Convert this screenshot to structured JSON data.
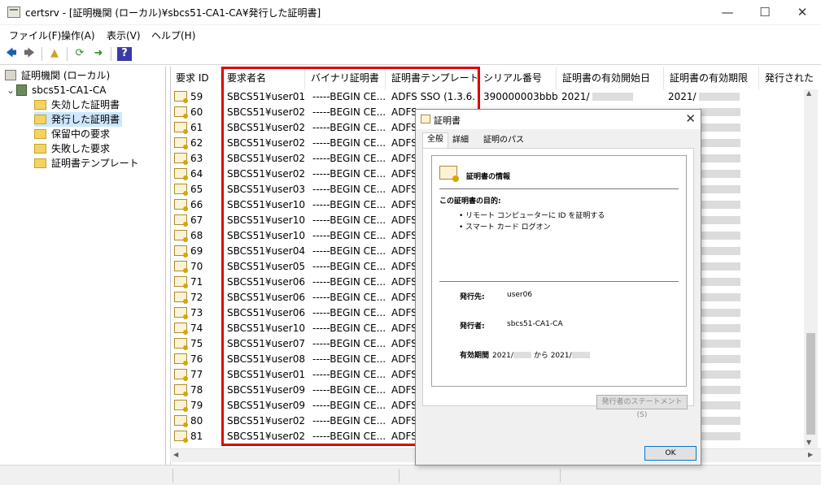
{
  "window": {
    "title": "certsrv - [証明機関 (ローカル)¥sbcs51-CA1-CA¥発行した証明書]",
    "controls": [
      "—",
      "☐",
      "✕"
    ]
  },
  "menu": [
    "ファイル(F)",
    "操作(A)",
    "表示(V)",
    "ヘルプ(H)"
  ],
  "toolbar": {
    "back": "🡄",
    "forward": "🡆",
    "up": "▲",
    "refresh": "⟳",
    "export": "➜",
    "help": "?"
  },
  "tree": {
    "root": "証明機関 (ローカル)",
    "ca": "sbcs51-CA1-CA",
    "expand_glyph": "⌄",
    "folders": [
      "失効した証明書",
      "発行した証明書",
      "保留中の要求",
      "失敗した要求",
      "証明書テンプレート"
    ],
    "selected_index": 1
  },
  "list": {
    "columns": [
      "要求 ID",
      "要求者名",
      "バイナリ証明書",
      "証明書テンプレート",
      "シリアル番号",
      "証明書の有効開始日",
      "証明書の有効期限",
      "発行された"
    ],
    "first_row": {
      "template": "ADFS SSO (1.3.6.1...",
      "serial": "390000003bbb...",
      "start": "2021/",
      "expire": "2021/"
    },
    "rows": [
      {
        "id": "59",
        "requester": "SBCS51¥user01",
        "binary": "-----BEGIN CE...",
        "template": "ADFS"
      },
      {
        "id": "60",
        "requester": "SBCS51¥user02",
        "binary": "-----BEGIN CE...",
        "template": "ADFS"
      },
      {
        "id": "61",
        "requester": "SBCS51¥user02",
        "binary": "-----BEGIN CE...",
        "template": "ADFS"
      },
      {
        "id": "62",
        "requester": "SBCS51¥user02",
        "binary": "-----BEGIN CE...",
        "template": "ADFS"
      },
      {
        "id": "63",
        "requester": "SBCS51¥user02",
        "binary": "-----BEGIN CE...",
        "template": "ADFS"
      },
      {
        "id": "64",
        "requester": "SBCS51¥user02",
        "binary": "-----BEGIN CE...",
        "template": "ADFS"
      },
      {
        "id": "65",
        "requester": "SBCS51¥user03",
        "binary": "-----BEGIN CE...",
        "template": "ADFS"
      },
      {
        "id": "66",
        "requester": "SBCS51¥user10",
        "binary": "-----BEGIN CE...",
        "template": "ADFS"
      },
      {
        "id": "67",
        "requester": "SBCS51¥user10",
        "binary": "-----BEGIN CE...",
        "template": "ADFS"
      },
      {
        "id": "68",
        "requester": "SBCS51¥user10",
        "binary": "-----BEGIN CE...",
        "template": "ADFS"
      },
      {
        "id": "69",
        "requester": "SBCS51¥user04",
        "binary": "-----BEGIN CE...",
        "template": "ADFS"
      },
      {
        "id": "70",
        "requester": "SBCS51¥user05",
        "binary": "-----BEGIN CE...",
        "template": "ADFS"
      },
      {
        "id": "71",
        "requester": "SBCS51¥user06",
        "binary": "-----BEGIN CE...",
        "template": "ADFS"
      },
      {
        "id": "72",
        "requester": "SBCS51¥user06",
        "binary": "-----BEGIN CE...",
        "template": "ADFS"
      },
      {
        "id": "73",
        "requester": "SBCS51¥user06",
        "binary": "-----BEGIN CE...",
        "template": "ADFS"
      },
      {
        "id": "74",
        "requester": "SBCS51¥user10",
        "binary": "-----BEGIN CE...",
        "template": "ADFS"
      },
      {
        "id": "75",
        "requester": "SBCS51¥user07",
        "binary": "-----BEGIN CE...",
        "template": "ADFS"
      },
      {
        "id": "76",
        "requester": "SBCS51¥user08",
        "binary": "-----BEGIN CE...",
        "template": "ADFS"
      },
      {
        "id": "77",
        "requester": "SBCS51¥user01",
        "binary": "-----BEGIN CE...",
        "template": "ADFS"
      },
      {
        "id": "78",
        "requester": "SBCS51¥user09",
        "binary": "-----BEGIN CE...",
        "template": "ADFS"
      },
      {
        "id": "79",
        "requester": "SBCS51¥user09",
        "binary": "-----BEGIN CE...",
        "template": "ADFS"
      },
      {
        "id": "80",
        "requester": "SBCS51¥user02",
        "binary": "-----BEGIN CE...",
        "template": "ADFS"
      },
      {
        "id": "81",
        "requester": "SBCS51¥user02",
        "binary": "-----BEGIN CE...",
        "template": "ADFS"
      }
    ]
  },
  "dialog": {
    "title": "証明書",
    "close": "✕",
    "tabs": [
      "全般",
      "詳細",
      "証明のパス"
    ],
    "active_tab": 0,
    "info_title": "証明書の情報",
    "purpose_heading": "この証明書の目的:",
    "purposes": [
      "• リモート コンピューターに ID を証明する",
      "• スマート カード ログオン"
    ],
    "issued_to_label": "発行先:",
    "issued_to": "user06",
    "issued_by_label": "発行者:",
    "issued_by": "sbcs51-CA1-CA",
    "validity_label": "有効期間",
    "validity_from": "2021/",
    "validity_sep": "から",
    "validity_to": "2021/",
    "statement_button": "発行者のステートメント(S)",
    "ok_button": "OK"
  },
  "scroll": {
    "up": "▲",
    "down": "▼",
    "left": "◀",
    "right": "▶"
  },
  "colors": {
    "highlight": "#e00000",
    "selection": "#cce8ff"
  }
}
